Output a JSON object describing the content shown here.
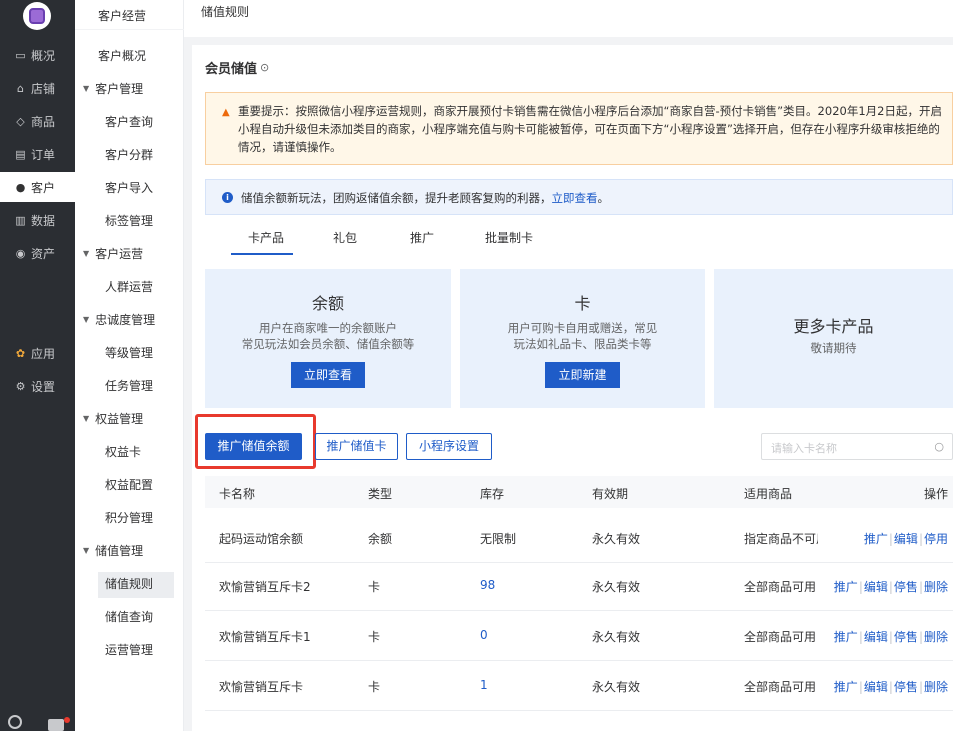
{
  "rail": {
    "items": [
      {
        "label": "概况",
        "icon": "monitor-icon",
        "glyph": "▭"
      },
      {
        "label": "店铺",
        "icon": "store-icon",
        "glyph": "⌂"
      },
      {
        "label": "商品",
        "icon": "tag-icon",
        "glyph": "◇"
      },
      {
        "label": "订单",
        "icon": "order-icon",
        "glyph": "▤"
      },
      {
        "label": "客户",
        "icon": "user-icon",
        "glyph": "●"
      },
      {
        "label": "数据",
        "icon": "chart-icon",
        "glyph": "▥"
      },
      {
        "label": "资产",
        "icon": "asset-icon",
        "glyph": "◉"
      },
      {
        "label": "应用",
        "icon": "apps-icon",
        "glyph": "✿"
      },
      {
        "label": "设置",
        "icon": "gear-icon",
        "glyph": "⚙"
      }
    ]
  },
  "side": {
    "header": "客户经营",
    "overview": "客户概况",
    "groups": [
      {
        "label": "客户管理",
        "links": [
          "客户查询",
          "客户分群",
          "客户导入",
          "标签管理"
        ]
      },
      {
        "label": "客户运营",
        "links": [
          "人群运营"
        ]
      },
      {
        "label": "忠诚度管理",
        "links": [
          "等级管理",
          "任务管理"
        ]
      },
      {
        "label": "权益管理",
        "links": [
          "权益卡",
          "权益配置",
          "积分管理"
        ]
      },
      {
        "label": "储值管理",
        "links": [
          "储值规则",
          "储值查询",
          "运营管理"
        ]
      }
    ]
  },
  "breadcrumb": "储值规则",
  "page_title": "会员储值",
  "warning": "重要提示：按照微信小程序运营规则，商家开展预付卡销售需在微信小程序后台添加“商家自营-预付卡销售”类目。2020年1月2日起，开启小程自动升级但未添加类目的商家，小程序端充值与购卡可能被暂停，可在页面下方“小程序设置”选择开启，但存在小程序升级审核拒绝的情况，请谨慎操作。",
  "info": {
    "text": "储值余额新玩法，团购返储值余额，提升老顾客复购的利器，",
    "link": "立即查看",
    "tail": "。"
  },
  "tabs": [
    "卡产品",
    "礼包",
    "推广",
    "批量制卡"
  ],
  "cards": [
    {
      "title": "余额",
      "desc1": "用户在商家唯一的余额账户",
      "desc2": "常见玩法如会员余额、储值余额等",
      "button": "立即查看"
    },
    {
      "title": "卡",
      "desc1": "用户可购卡自用或赠送，常见",
      "desc2": "玩法如礼品卡、限品类卡等",
      "button": "立即新建"
    },
    {
      "title": "更多卡产品",
      "desc1": "敬请期待"
    }
  ],
  "actions": {
    "promote_balance": "推广储值余额",
    "promote_card": "推广储值卡",
    "mini_settings": "小程序设置"
  },
  "search": {
    "placeholder": "请输入卡名称"
  },
  "table": {
    "headers": [
      "卡名称",
      "类型",
      "库存",
      "有效期",
      "适用商品",
      "操作"
    ],
    "rows": [
      {
        "name": "起码运动馆余额",
        "type": "余额",
        "stock": "无限制",
        "validity": "永久有效",
        "scope": "指定商品不可用",
        "ops": [
          "推广",
          "编辑",
          "停用"
        ]
      },
      {
        "name": "欢愉营销互斥卡2",
        "type": "卡",
        "stock": "98",
        "validity": "永久有效",
        "scope": "全部商品可用",
        "ops": [
          "推广",
          "编辑",
          "停售",
          "删除"
        ]
      },
      {
        "name": "欢愉营销互斥卡1",
        "type": "卡",
        "stock": "0",
        "validity": "永久有效",
        "scope": "全部商品可用",
        "ops": [
          "推广",
          "编辑",
          "停售",
          "删除"
        ]
      },
      {
        "name": "欢愉营销互斥卡",
        "type": "卡",
        "stock": "1",
        "validity": "永久有效",
        "scope": "全部商品可用",
        "ops": [
          "推广",
          "编辑",
          "停售",
          "删除"
        ]
      }
    ]
  },
  "colors": {
    "primary": "#1f5cc8",
    "highlight": "#e8392d",
    "rail": "#2b2e33"
  }
}
